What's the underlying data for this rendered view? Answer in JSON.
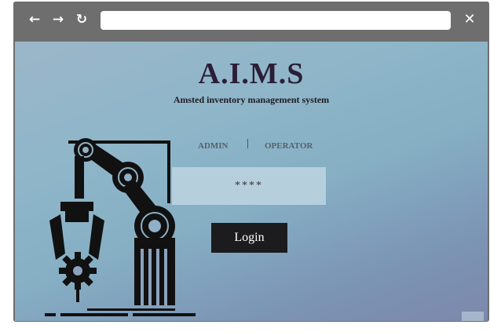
{
  "browser": {
    "back_icon": "arrow-left-icon",
    "forward_icon": "arrow-right-icon",
    "reload_icon": "reload-icon",
    "close_icon": "close-icon",
    "url_value": ""
  },
  "app": {
    "title": "A.I.M.S",
    "subtitle": "Amsted inventory management system"
  },
  "tabs": [
    {
      "label": "ADMIN"
    },
    {
      "label": "OPERATOR"
    }
  ],
  "password": {
    "value": "****"
  },
  "login_label": "Login",
  "colors": {
    "toolbar": "#6e6e6e",
    "title": "#2b1e37",
    "button": "#1c1c1e",
    "field": "#b6cfdd"
  },
  "illustration": "robotic-arm-icon"
}
